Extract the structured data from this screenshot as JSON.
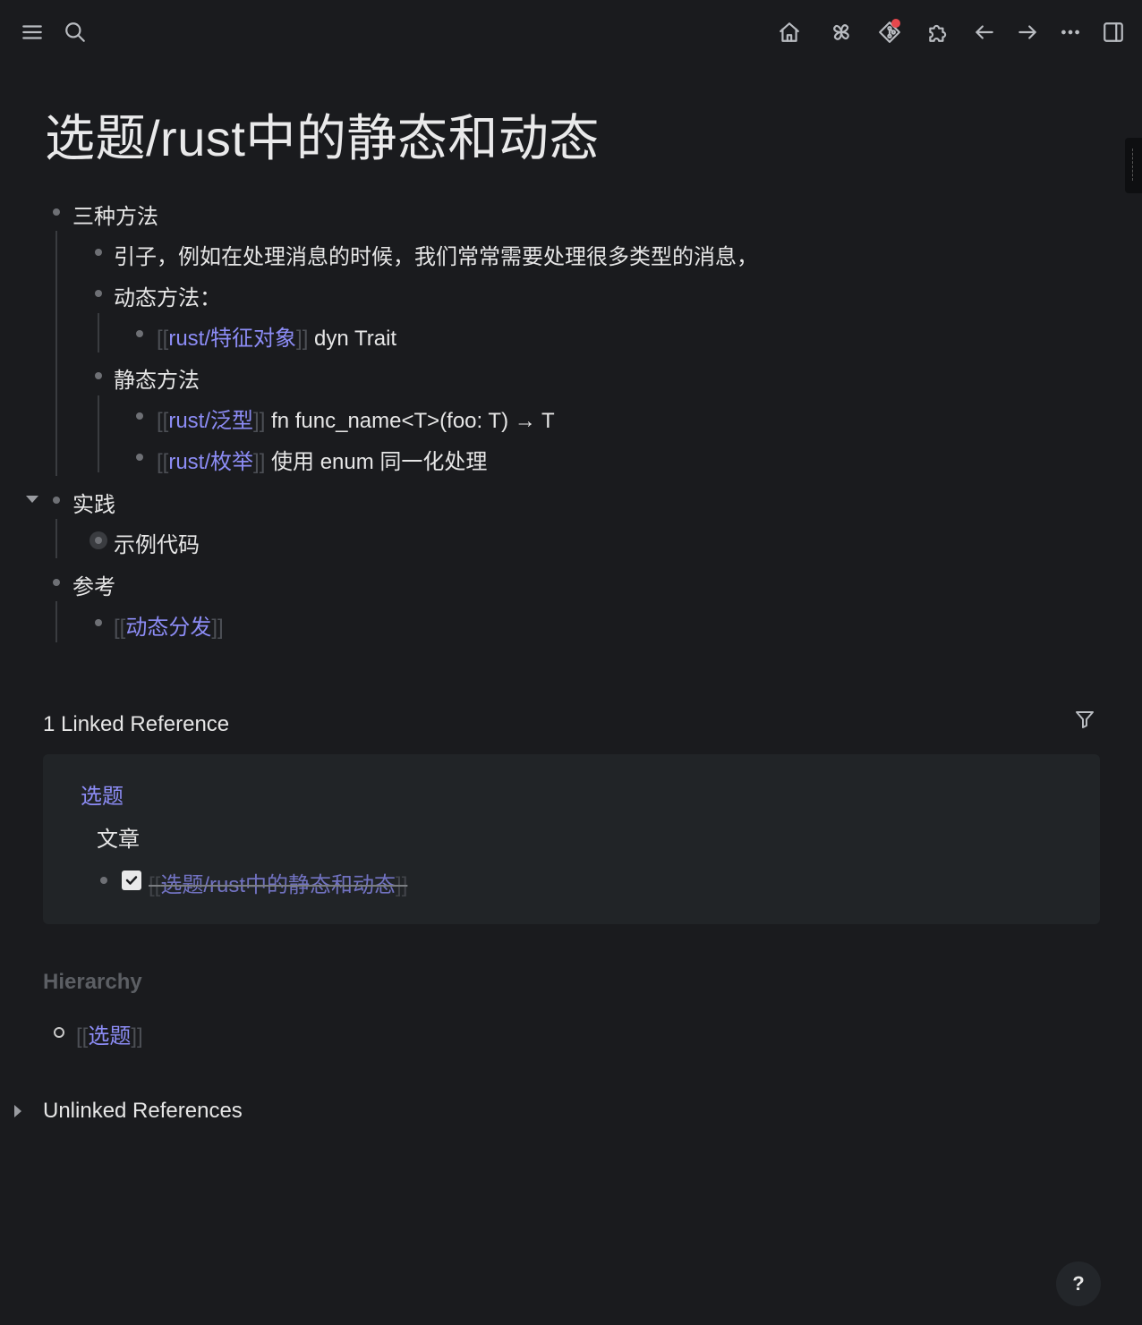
{
  "page": {
    "title": "选题/rust中的静态和动态"
  },
  "toolbar": {
    "icons": [
      "menu-icon",
      "search-icon",
      "home-icon",
      "pinwheel-icon",
      "git-icon",
      "puzzle-icon",
      "arrow-left-icon",
      "arrow-right-icon",
      "more-icon",
      "sidebar-icon"
    ],
    "notification_color": "#e5484d"
  },
  "blocks": {
    "b1": {
      "text": "三种方法"
    },
    "b1_1": {
      "text": "引子，例如在处理消息的时候，我们常常需要处理很多类型的消息，"
    },
    "b1_2": {
      "text": "动态方法："
    },
    "b1_2_1": {
      "link": "rust/特征对象",
      "text": " dyn Trait"
    },
    "b1_3": {
      "text": "静态方法"
    },
    "b1_3_1": {
      "link": "rust/泛型",
      "text": " fn func_name<T>(foo: T) → T"
    },
    "b1_3_2": {
      "link": "rust/枚举",
      "text": " 使用 enum 同一化处理"
    },
    "b2": {
      "text": "实践"
    },
    "b2_1": {
      "text": "示例代码"
    },
    "b3": {
      "text": "参考"
    },
    "b3_1": {
      "link": "动态分发"
    }
  },
  "brackets": {
    "open": "[[",
    "close": "]]"
  },
  "linked_references": {
    "heading": "1 Linked Reference",
    "page_link": "选题",
    "parent_text": "文章",
    "item_link": "选题/rust中的静态和动态",
    "item_done": true
  },
  "hierarchy": {
    "heading": "Hierarchy",
    "link": "选题"
  },
  "unlinked_references": {
    "heading": "Unlinked References"
  },
  "help": {
    "label": "?"
  },
  "colors": {
    "background": "#1a1b1e",
    "link": "#8c8cf5",
    "card": "#212427"
  }
}
